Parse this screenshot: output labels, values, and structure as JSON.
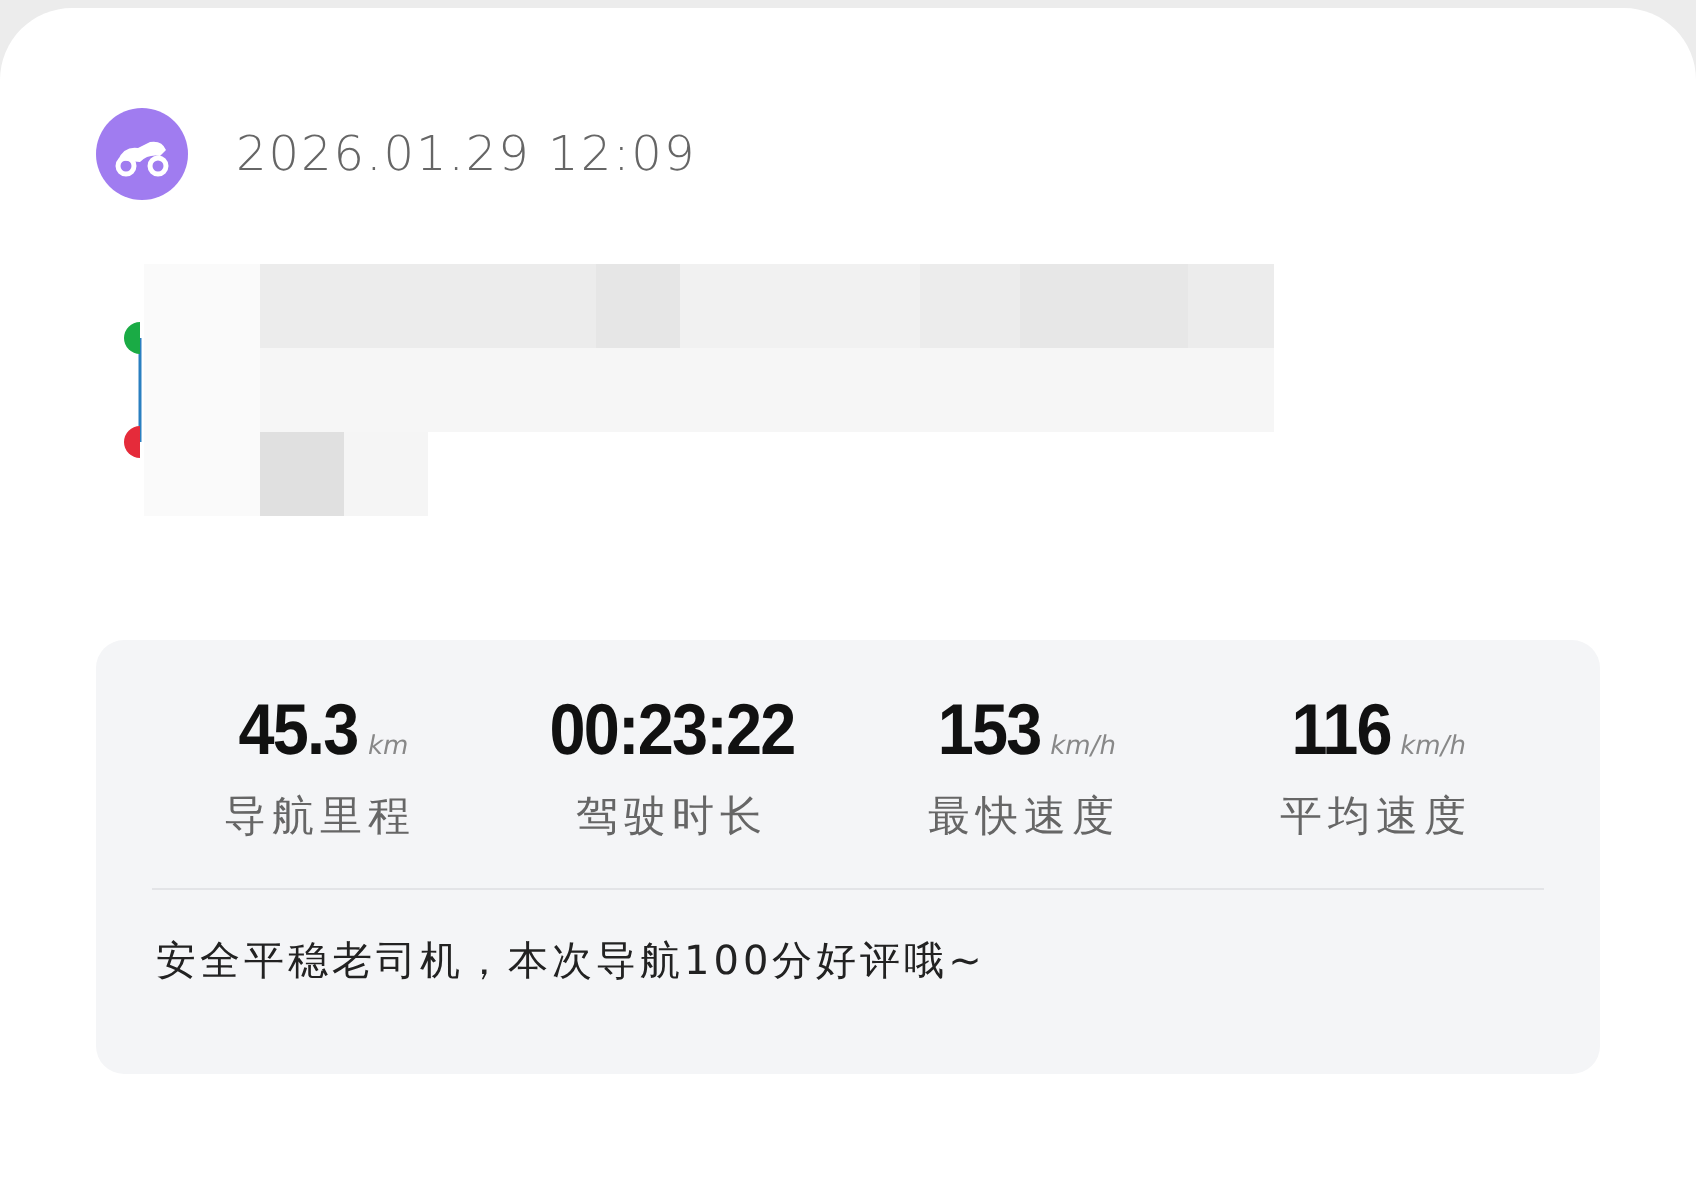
{
  "trip": {
    "datetime": "2026.01.29 12:09"
  },
  "stats": [
    {
      "value": "45.3",
      "unit": "km",
      "label": "导航里程"
    },
    {
      "value": "00:23:22",
      "label": "驾驶时长"
    },
    {
      "value": "153",
      "unit": "km/h",
      "label": "最快速度"
    },
    {
      "value": "116",
      "unit": "km/h",
      "label": "平均速度"
    }
  ],
  "message": "安全平稳老司机，本次导航100分好评哦~"
}
